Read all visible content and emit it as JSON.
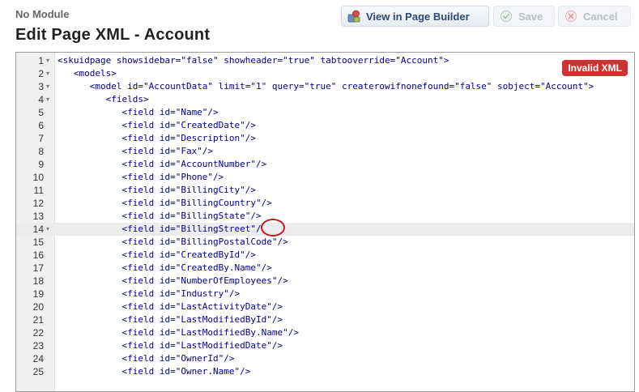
{
  "header": {
    "module_label": "No Module",
    "page_title": "Edit Page XML - Account"
  },
  "toolbar": {
    "builder_label": "View in Page Builder",
    "save_label": "Save",
    "cancel_label": "Cancel"
  },
  "editor": {
    "badge": "Invalid XML",
    "active_line": 14,
    "lines": [
      {
        "num": "1",
        "fold": true,
        "code": "<skuidpage showsidebar=\"false\" showheader=\"true\" tabtooverride=\"Account\">"
      },
      {
        "num": "2",
        "fold": true,
        "code": "   <models>"
      },
      {
        "num": "3",
        "fold": true,
        "code": "      <model id=\"AccountData\" limit=\"1\" query=\"true\" createrowifnonefound=\"false\" sobject=\"Account\">"
      },
      {
        "num": "4",
        "fold": true,
        "code": "         <fields>"
      },
      {
        "num": "5",
        "fold": false,
        "code": "            <field id=\"Name\"/>"
      },
      {
        "num": "6",
        "fold": false,
        "code": "            <field id=\"CreatedDate\"/>"
      },
      {
        "num": "7",
        "fold": false,
        "code": "            <field id=\"Description\"/>"
      },
      {
        "num": "8",
        "fold": false,
        "code": "            <field id=\"Fax\"/>"
      },
      {
        "num": "9",
        "fold": false,
        "code": "            <field id=\"AccountNumber\"/>"
      },
      {
        "num": "10",
        "fold": false,
        "code": "            <field id=\"Phone\"/>"
      },
      {
        "num": "11",
        "fold": false,
        "code": "            <field id=\"BillingCity\"/>"
      },
      {
        "num": "12",
        "fold": false,
        "code": "            <field id=\"BillingCountry\"/>"
      },
      {
        "num": "13",
        "fold": false,
        "code": "            <field id=\"BillingState\"/>"
      },
      {
        "num": "14",
        "fold": true,
        "code": "            <field id=\"BillingStreet\"/"
      },
      {
        "num": "15",
        "fold": false,
        "code": "            <field id=\"BillingPostalCode\"/>"
      },
      {
        "num": "16",
        "fold": false,
        "code": "            <field id=\"CreatedById\"/>"
      },
      {
        "num": "17",
        "fold": false,
        "code": "            <field id=\"CreatedBy.Name\"/>"
      },
      {
        "num": "18",
        "fold": false,
        "code": "            <field id=\"NumberOfEmployees\"/>"
      },
      {
        "num": "19",
        "fold": false,
        "code": "            <field id=\"Industry\"/>"
      },
      {
        "num": "20",
        "fold": false,
        "code": "            <field id=\"LastActivityDate\"/>"
      },
      {
        "num": "21",
        "fold": false,
        "code": "            <field id=\"LastModifiedById\"/>"
      },
      {
        "num": "22",
        "fold": false,
        "code": "            <field id=\"LastModifiedBy.Name\"/>"
      },
      {
        "num": "23",
        "fold": false,
        "code": "            <field id=\"LastModifiedDate\"/>"
      },
      {
        "num": "24",
        "fold": false,
        "code": "            <field id=\"OwnerId\"/>"
      },
      {
        "num": "25",
        "fold": false,
        "code": "            <field id=\"Owner.Name\"/>"
      }
    ]
  },
  "icons": {
    "builder": "page-builder-icon",
    "save": "check-circle-icon",
    "cancel": "cancel-circle-icon"
  },
  "colors": {
    "badge_bg": "#cc3333",
    "code_text": "#00008a",
    "error_mark": "#c01818"
  }
}
